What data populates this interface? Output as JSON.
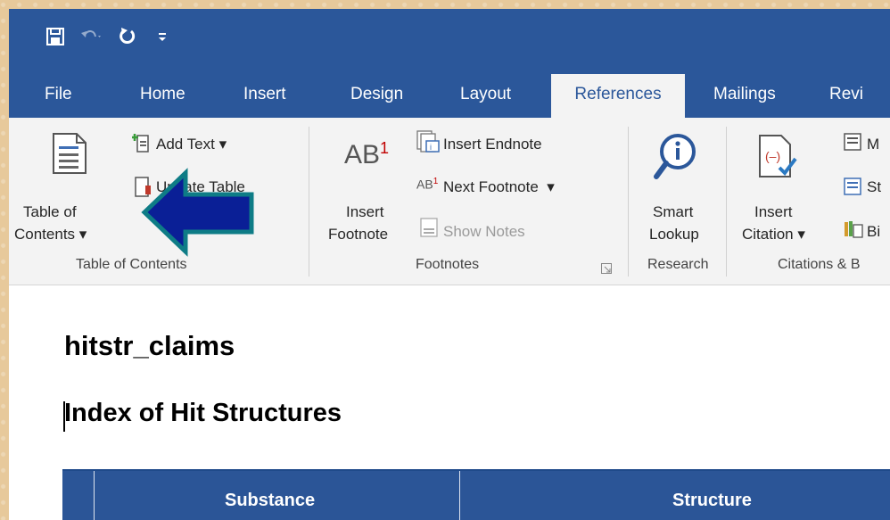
{
  "colors": {
    "accent": "#2b579a",
    "arrow_fill": "#0a1f96",
    "arrow_outline": "#0e7c86",
    "footnote_marker": "#c00000"
  },
  "quick_access": {
    "save_icon": "save-icon",
    "undo_icon": "undo-icon",
    "redo_icon": "redo-icon",
    "customize_icon": "customize-qat-icon"
  },
  "tabs": [
    "File",
    "Home",
    "Insert",
    "Design",
    "Layout",
    "References",
    "Mailings",
    "Revi"
  ],
  "active_tab": "References",
  "ribbon": {
    "toc": {
      "btn_line1": "Table of",
      "btn_line2": "Contents",
      "add_text": "Add Text",
      "update_table": "Update Table",
      "group_label": "Table of Contents"
    },
    "footnotes": {
      "insert_line1": "Insert",
      "insert_line2": "Footnote",
      "insert_endnote": "Insert Endnote",
      "next_footnote": "Next Footnote",
      "show_notes": "Show Notes",
      "group_label": "Footnotes"
    },
    "research": {
      "smart_line1": "Smart",
      "smart_line2": "Lookup",
      "group_label": "Research"
    },
    "citations": {
      "insert_line1": "Insert",
      "insert_line2": "Citation",
      "manage": "M",
      "style": "St",
      "bib": "Bi",
      "group_label": "Citations & B"
    }
  },
  "document": {
    "title": "hitstr_claims",
    "heading": "Index of Hit Structures",
    "table_headers": [
      "",
      "Substance",
      "Structure"
    ]
  }
}
